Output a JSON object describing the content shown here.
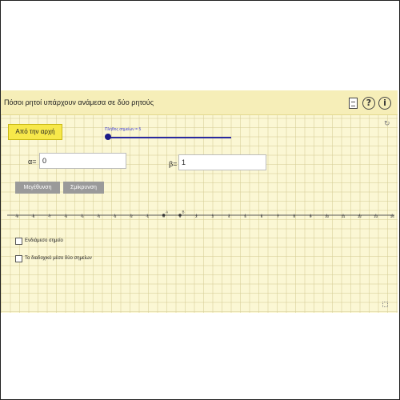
{
  "applet": {
    "title": "Πόσοι ρητοί υπάρχουν ανάμεσα σε δύο ρητούς",
    "header_icons": [
      "document-icon",
      "help-icon",
      "info-icon"
    ]
  },
  "controls": {
    "reset_label": "Από την αρχή",
    "slider_label": "Πλήθος σημείων = 5",
    "slider_value": 5,
    "alpha_label": "α=",
    "alpha_value": "0",
    "beta_label": "β=",
    "beta_value": "1",
    "zoom_in_label": "Μεγέθυνση",
    "zoom_out_label": "Σμίκρυνση"
  },
  "number_line": {
    "tick_labels": [
      "-9",
      "-8",
      "-7",
      "-6",
      "-5",
      "-4",
      "-3",
      "-2",
      "-1",
      "0",
      "1",
      "2",
      "3",
      "4",
      "5",
      "6",
      "7",
      "8",
      "9",
      "10",
      "11",
      "12",
      "13",
      "14"
    ],
    "points": [
      {
        "label": "A",
        "value": 0
      },
      {
        "label": "B",
        "value": 1
      }
    ]
  },
  "checkboxes": [
    {
      "label": "Ενδιάμεσο σημείο",
      "checked": false
    },
    {
      "label": "Το διαδοχικό μέσο δύο σημείων",
      "checked": false
    }
  ],
  "colors": {
    "applet_bg": "#fbf7d4",
    "reset_button": "#f7e84a",
    "slider": "#2a2aa0",
    "gray_button": "#9a9a9a"
  }
}
